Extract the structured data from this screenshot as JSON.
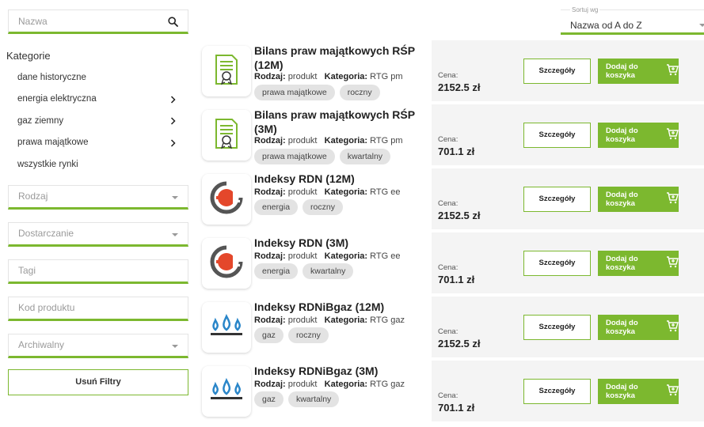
{
  "search": {
    "placeholder": "Nazwa"
  },
  "categories": {
    "title": "Kategorie",
    "items": [
      {
        "label": "dane historyczne",
        "has_children": false
      },
      {
        "label": "energia elektryczna",
        "has_children": true
      },
      {
        "label": "gaz ziemny",
        "has_children": true
      },
      {
        "label": "prawa majątkowe",
        "has_children": true
      },
      {
        "label": "wszystkie rynki",
        "has_children": false
      }
    ]
  },
  "filters": {
    "rodzaj": "Rodzaj",
    "dostarczanie": "Dostarczanie",
    "tagi": "Tagi",
    "kod": "Kod produktu",
    "archiwalny": "Archiwalny",
    "clear_label": "Usuń Filtry"
  },
  "sort": {
    "label": "Sortuj wg",
    "value": "Nazwa od A do Z"
  },
  "labels": {
    "type": "Rodzaj:",
    "category": "Kategoria:",
    "price": "Cena:",
    "details": "Szczegóły",
    "add_to_cart": "Dodaj do koszyka"
  },
  "colors": {
    "accent": "#7cb82f"
  },
  "products": [
    {
      "name": "Bilans praw majątkowych RŚP (12M)",
      "type": "produkt",
      "category": "RTG pm",
      "tags": [
        "prawa majątkowe",
        "roczny"
      ],
      "price": "2152.5 zł",
      "icon": "certificate-icon"
    },
    {
      "name": "Bilans praw majątkowych RŚP (3M)",
      "type": "produkt",
      "category": "RTG pm",
      "tags": [
        "prawa majątkowe",
        "kwartalny"
      ],
      "price": "701.1 zł",
      "icon": "certificate-icon"
    },
    {
      "name": "Indeksy RDN (12M)",
      "type": "produkt",
      "category": "RTG ee",
      "tags": [
        "energia",
        "roczny"
      ],
      "price": "2152.5 zł",
      "icon": "plug-icon"
    },
    {
      "name": "Indeksy RDN (3M)",
      "type": "produkt",
      "category": "RTG ee",
      "tags": [
        "energia",
        "kwartalny"
      ],
      "price": "701.1 zł",
      "icon": "plug-icon"
    },
    {
      "name": "Indeksy RDNiBgaz (12M)",
      "type": "produkt",
      "category": "RTG gaz",
      "tags": [
        "gaz",
        "roczny"
      ],
      "price": "2152.5 zł",
      "icon": "gas-flame-icon"
    },
    {
      "name": "Indeksy RDNiBgaz (3M)",
      "type": "produkt",
      "category": "RTG gaz",
      "tags": [
        "gaz",
        "kwartalny"
      ],
      "price": "701.1 zł",
      "icon": "gas-flame-icon"
    }
  ]
}
